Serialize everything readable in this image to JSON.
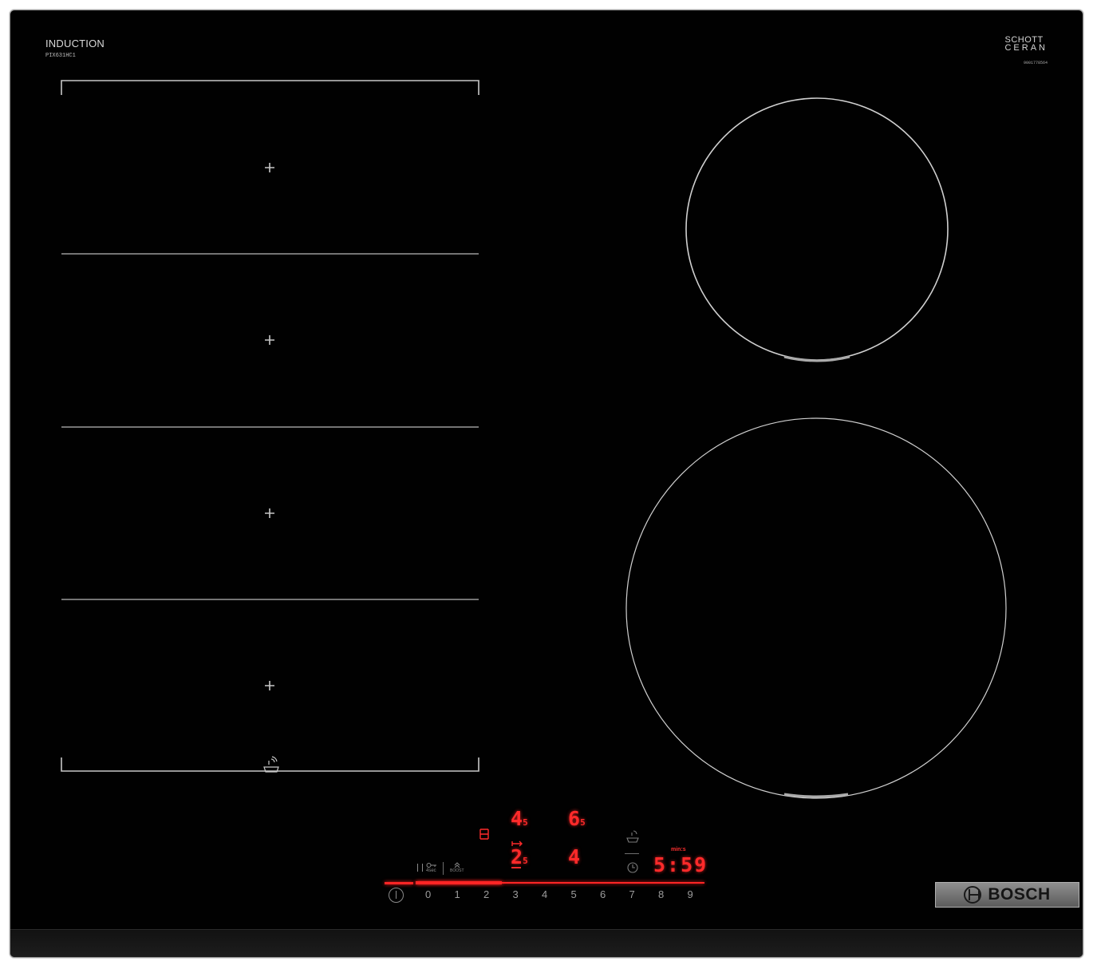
{
  "hob": {
    "type_label": "INDUCTION",
    "model": "PIX631HC1",
    "glass_brand_line1": "SCHOTT",
    "glass_brand_line2": "CERAN",
    "serial": "9001778564",
    "brand": "BOSCH"
  },
  "zones": {
    "flex_zone_sections": 4,
    "round_small": "front-right small",
    "round_large": "rear-right large"
  },
  "displays": {
    "zone1_level": "4",
    "zone1_sub": "5",
    "zone2_level": "6",
    "zone2_sub": "5",
    "zone3_level": "2",
    "zone3_sub": "5",
    "zone4_level": "4",
    "timer": "5:59",
    "timer_unit": "min:s"
  },
  "controls": {
    "lock_label": "4sec",
    "boost_label": "BOOST",
    "scale": [
      "0",
      "1",
      "2",
      "3",
      "4",
      "5",
      "6",
      "7",
      "8",
      "9"
    ]
  },
  "colors": {
    "glass": "#010101",
    "display_red": "#ff2a2a",
    "marking_grey": "#c8c8c8"
  }
}
